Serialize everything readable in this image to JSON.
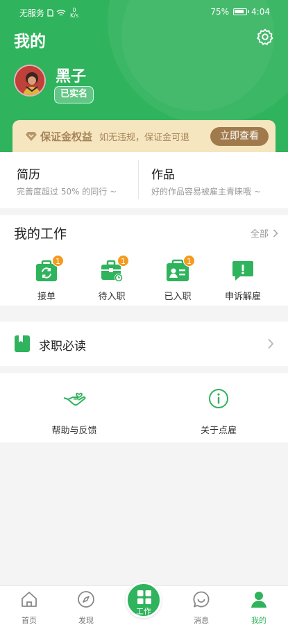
{
  "status_bar": {
    "carrier": "无服务",
    "speed": "0",
    "speed_unit": "K/s",
    "battery": "75%",
    "time": "4:04"
  },
  "header": {
    "title": "我的",
    "username": "黑子",
    "verified_label": "已实名"
  },
  "deposit": {
    "title": "保证金权益",
    "text": "如无违规，保证金可退",
    "button": "立即查看"
  },
  "resume": {
    "title": "简历",
    "subtitle": "完善度超过 50% 的同行 ~"
  },
  "works": {
    "title": "作品",
    "subtitle": "好的作品容易被雇主青睐哦 ~"
  },
  "my_work": {
    "title": "我的工作",
    "all_label": "全部",
    "items": [
      {
        "label": "接单",
        "badge": "1",
        "icon": "order-icon"
      },
      {
        "label": "待入职",
        "badge": "1",
        "icon": "pending-job-icon"
      },
      {
        "label": "已入职",
        "badge": "1",
        "icon": "employed-icon"
      },
      {
        "label": "申诉解雇",
        "badge": "",
        "icon": "appeal-icon"
      }
    ]
  },
  "must_read": {
    "label": "求职必读"
  },
  "help": [
    {
      "label": "帮助与反馈",
      "icon": "help-hand-icon"
    },
    {
      "label": "关于点雇",
      "icon": "info-icon"
    }
  ],
  "tabbar": [
    {
      "label": "首页",
      "icon": "home-icon"
    },
    {
      "label": "发现",
      "icon": "compass-icon"
    },
    {
      "label": "工作",
      "icon": "grid-icon"
    },
    {
      "label": "消息",
      "icon": "message-icon"
    },
    {
      "label": "我的",
      "icon": "person-icon"
    }
  ],
  "colors": {
    "primary": "#2fb35c",
    "badge": "#f59a1c",
    "gold": "#a07a4c"
  }
}
